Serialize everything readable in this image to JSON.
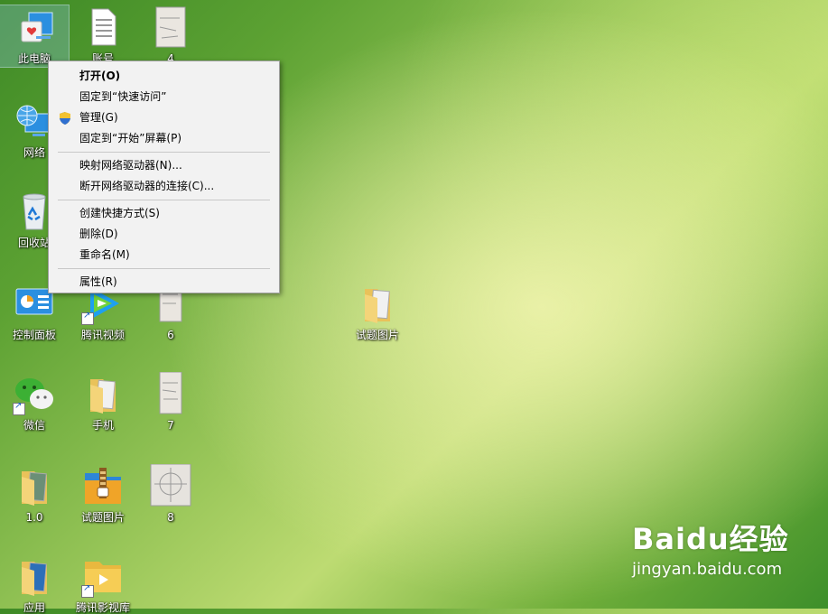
{
  "desktop_icons": [
    {
      "label": "此电脑",
      "icon": "computer-icon"
    },
    {
      "label": "账号",
      "icon": "document-icon"
    },
    {
      "label": "4",
      "icon": "image-file-icon"
    },
    {
      "label": "网络",
      "icon": "network-icon"
    },
    {
      "label": "回收站",
      "icon": "recycle-bin-icon"
    },
    {
      "label": "控制面板",
      "icon": "control-panel-icon"
    },
    {
      "label": "腾讯视频",
      "icon": "tencent-video-icon"
    },
    {
      "label": "6",
      "icon": "image-file-icon"
    },
    {
      "label": "试题图片",
      "icon": "folder-icon"
    },
    {
      "label": "微信",
      "icon": "wechat-icon"
    },
    {
      "label": "手机",
      "icon": "folder-icon"
    },
    {
      "label": "7",
      "icon": "image-file-icon"
    },
    {
      "label": "1.0",
      "icon": "folder-icon"
    },
    {
      "label": "试题图片",
      "icon": "winrar-archive-icon"
    },
    {
      "label": "8",
      "icon": "image-file-icon"
    },
    {
      "label": "应用",
      "icon": "folder-icon"
    },
    {
      "label": "腾讯影视库",
      "icon": "folder-icon"
    }
  ],
  "context_menu": {
    "items": [
      {
        "label": "打开(O)",
        "bold": true
      },
      {
        "label": "固定到“快速访问”"
      },
      {
        "label": "管理(G)",
        "icon": "uac-shield-icon"
      },
      {
        "label": "固定到“开始”屏幕(P)"
      },
      {
        "label": "映射网络驱动器(N)..."
      },
      {
        "label": "断开网络驱动器的连接(C)..."
      },
      {
        "label": "创建快捷方式(S)"
      },
      {
        "label": "删除(D)"
      },
      {
        "label": "重命名(M)"
      },
      {
        "label": "属性(R)"
      }
    ]
  },
  "watermark": {
    "brand": "Baidu经验",
    "url": "jingyan.baidu.com"
  }
}
